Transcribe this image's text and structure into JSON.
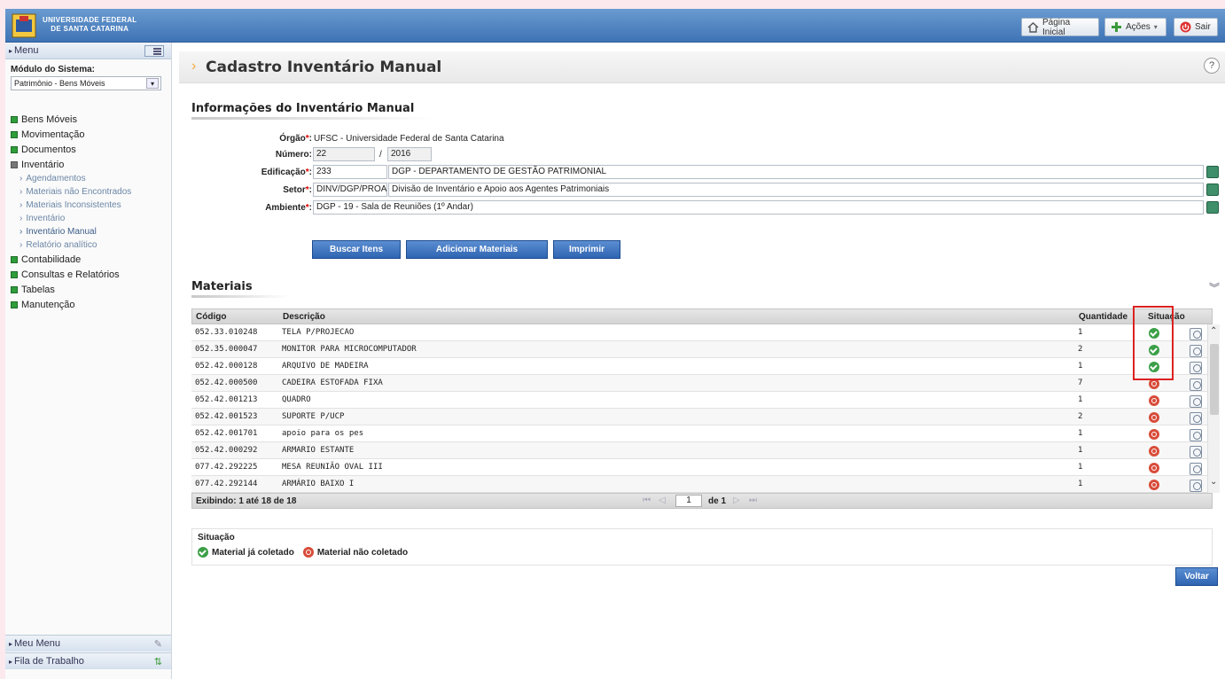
{
  "header": {
    "university_line1": "UNIVERSIDADE FEDERAL",
    "university_line2": "DE SANTA CATARINA",
    "home_label": "Página Inicial",
    "actions_label": "Ações",
    "exit_label": "Sair"
  },
  "sidebar": {
    "menu_label": "Menu",
    "module_label": "Módulo do Sistema:",
    "module_value": "Patrimônio - Bens Móveis",
    "items": [
      {
        "label": "Bens Móveis"
      },
      {
        "label": "Movimentação"
      },
      {
        "label": "Documentos"
      },
      {
        "label": "Inventário"
      }
    ],
    "inventario_sub": [
      {
        "label": "Agendamentos"
      },
      {
        "label": "Materiais não Encontrados"
      },
      {
        "label": "Materiais Inconsistentes"
      },
      {
        "label": "Inventário"
      },
      {
        "label": "Inventário Manual"
      },
      {
        "label": "Relatório analítico"
      }
    ],
    "items_after": [
      {
        "label": "Contabilidade"
      },
      {
        "label": "Consultas e Relatórios"
      },
      {
        "label": "Tabelas"
      },
      {
        "label": "Manutenção"
      }
    ],
    "meu_menu": "Meu Menu",
    "fila_trabalho": "Fila de Trabalho"
  },
  "page": {
    "title": "Cadastro Inventário Manual",
    "help": "?"
  },
  "info": {
    "section_title": "Informações do Inventário Manual",
    "orgao_label": "Órgão",
    "orgao_value": "UFSC - Universidade Federal de Santa Catarina",
    "numero_label": "Número:",
    "numero_value": "22",
    "numero_sep": "/",
    "ano_value": "2016",
    "edificacao_label": "Edificação",
    "edificacao_code": "233",
    "edificacao_desc": "DGP - DEPARTAMENTO DE GESTÃO PATRIMONIAL",
    "setor_label": "Setor",
    "setor_code": "DINV/DGP/PROA",
    "setor_desc": "Divisão de Inventário e Apoio aos Agentes Patrimoniais",
    "ambiente_label": "Ambiente",
    "ambiente_value": "DGP - 19 - Sala de Reuniões (1º Andar)"
  },
  "buttons": {
    "buscar": "Buscar Itens",
    "adicionar": "Adicionar Materiais",
    "imprimir": "Imprimir",
    "voltar": "Voltar"
  },
  "materiais": {
    "section_title": "Materiais",
    "columns": {
      "codigo": "Código",
      "descricao": "Descrição",
      "quantidade": "Quantidade",
      "situacao": "Situação"
    },
    "rows": [
      {
        "codigo": "052.33.010248",
        "descricao": "TELA P/PROJECAO",
        "quantidade": "1",
        "coletado": true
      },
      {
        "codigo": "052.35.000047",
        "descricao": "MONITOR PARA MICROCOMPUTADOR",
        "quantidade": "2",
        "coletado": true
      },
      {
        "codigo": "052.42.000128",
        "descricao": "ARQUIVO DE MADEIRA",
        "quantidade": "1",
        "coletado": true
      },
      {
        "codigo": "052.42.000500",
        "descricao": "CADEIRA ESTOFADA FIXA",
        "quantidade": "7",
        "coletado": false
      },
      {
        "codigo": "052.42.001213",
        "descricao": "QUADRO",
        "quantidade": "1",
        "coletado": false
      },
      {
        "codigo": "052.42.001523",
        "descricao": "SUPORTE P/UCP",
        "quantidade": "2",
        "coletado": false
      },
      {
        "codigo": "052.42.001701",
        "descricao": "apoio para os pes",
        "quantidade": "1",
        "coletado": false
      },
      {
        "codigo": "052.42.000292",
        "descricao": "ARMARIO ESTANTE",
        "quantidade": "1",
        "coletado": false
      },
      {
        "codigo": "077.42.292225",
        "descricao": "MESA REUNIÃO OVAL III",
        "quantidade": "1",
        "coletado": false
      },
      {
        "codigo": "077.42.292144",
        "descricao": "ARMÁRIO BAIXO I",
        "quantidade": "1",
        "coletado": false
      }
    ],
    "footer_text": "Exibindo: 1 até 18 de 18",
    "page_value": "1",
    "page_of": "de 1"
  },
  "legend": {
    "title": "Situação",
    "ok": "Material já coletado",
    "no": "Material não coletado"
  },
  "colors": {
    "header": "#3e73b5",
    "button": "#2f64b2",
    "status_ok": "#3b9f47",
    "status_no": "#d84c3a",
    "highlight": "#dd2222"
  }
}
